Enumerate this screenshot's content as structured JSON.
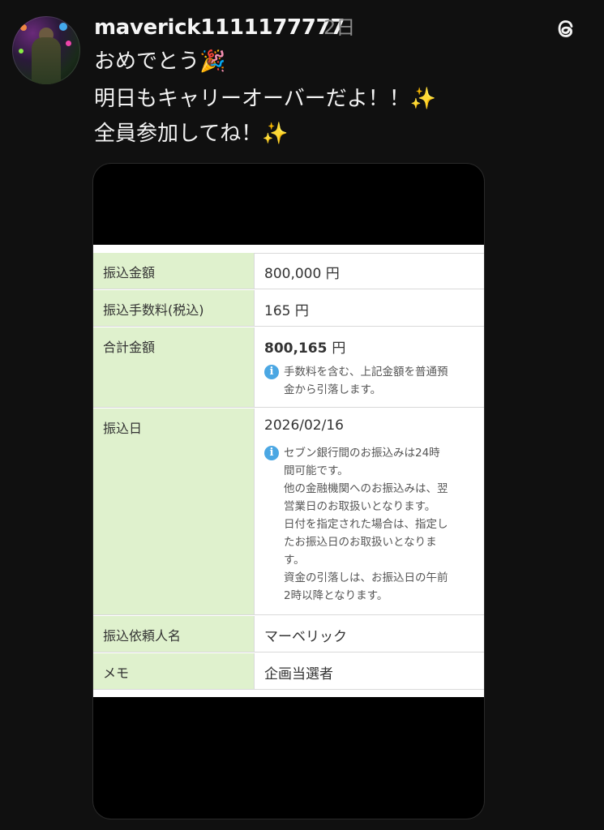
{
  "post": {
    "username": "maverick1111177777",
    "time": "2日",
    "lines": [
      "おめでとう🎉",
      "明日もキャリーオーバーだよ！！✨",
      "全員参加してね！✨"
    ]
  },
  "receipt": {
    "rows": [
      {
        "label": "振込金額",
        "value": "800,000",
        "unit": "円"
      },
      {
        "label": "振込手数料(税込)",
        "value": "165",
        "unit": "円"
      },
      {
        "label": "合計金額",
        "value": "800,165",
        "unit": "円",
        "note": [
          "手数料を含む、上記金額を普通預",
          "金から引落します。"
        ]
      },
      {
        "label": "振込日",
        "value": "2026/02/16",
        "note": [
          "セブン銀行間のお振込みは24時",
          "間可能です。",
          "他の金融機関へのお振込みは、翌",
          "営業日のお取扱いとなります。",
          "日付を指定された場合は、指定し",
          "たお振込日のお取扱いとなりま",
          "す。",
          "資金の引落しは、お振込日の午前",
          "2時以降となります。"
        ]
      },
      {
        "label": "振込依頼人名",
        "value": "マーベリック"
      },
      {
        "label": "メモ",
        "value": "企画当選者"
      }
    ],
    "info_icon": "i"
  },
  "icons": {
    "threads": "threads-logo-icon",
    "info": "info-icon"
  }
}
